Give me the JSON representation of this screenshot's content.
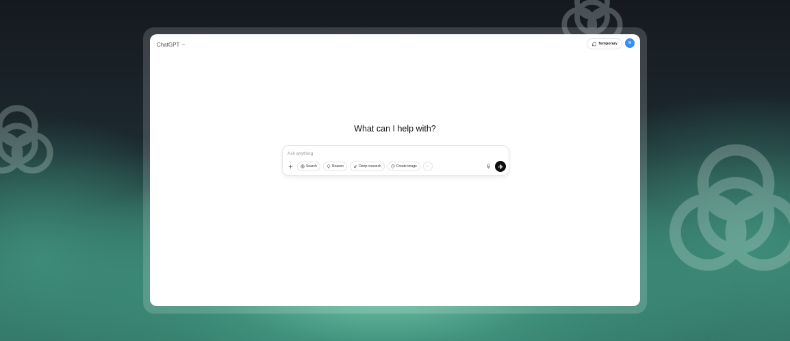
{
  "header": {
    "model_label": "ChatGPT",
    "temporary_label": "Temporary",
    "avatar_initial": "H"
  },
  "main": {
    "heading": "What can I help with?"
  },
  "composer": {
    "placeholder": "Ask anything",
    "tools": [
      {
        "label": "Search",
        "icon": "globe-icon"
      },
      {
        "label": "Reason",
        "icon": "lightbulb-icon"
      },
      {
        "label": "Deep research",
        "icon": "telescope-icon"
      },
      {
        "label": "Create image",
        "icon": "palette-icon"
      }
    ],
    "more_label": "···"
  },
  "colors": {
    "avatar": "#3a8ef0",
    "voice_button": "#0d0d0d"
  }
}
